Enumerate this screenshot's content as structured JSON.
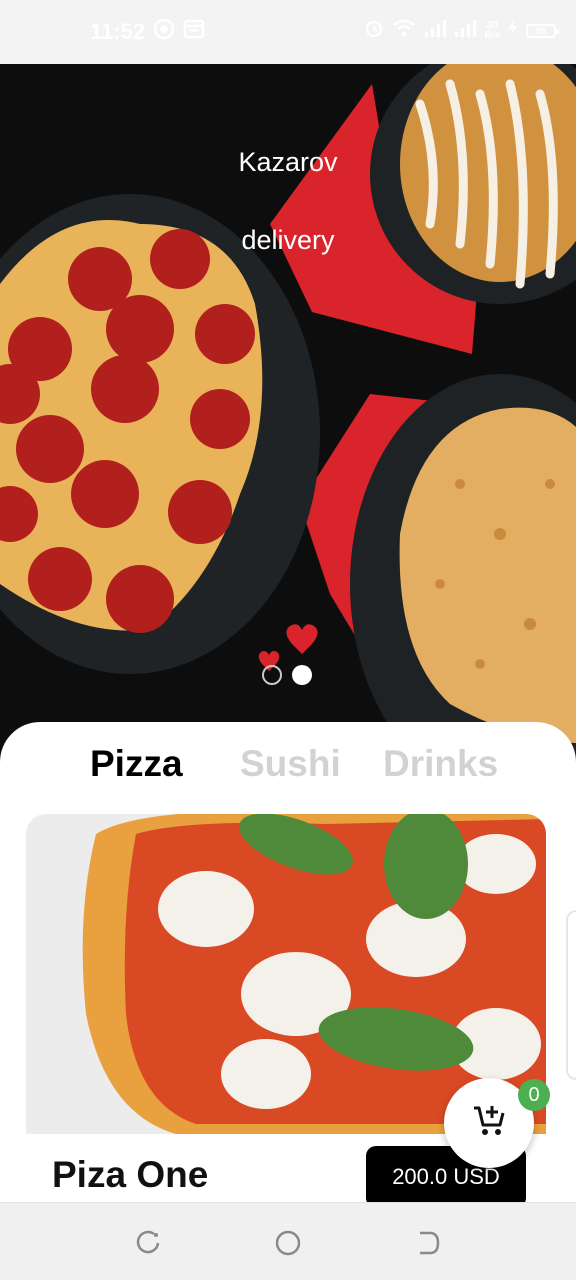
{
  "status_bar": {
    "time": "11:52",
    "net_speed_top": "30",
    "net_speed_bottom": "B/s",
    "battery": "55",
    "icons": [
      "whatsapp-icon",
      "calendar-icon",
      "alarm-icon",
      "wifi-icon",
      "signal-icon",
      "signal-icon",
      "charging-icon",
      "battery-icon"
    ]
  },
  "hero": {
    "title_line1": "Kazarov",
    "title_line2": "delivery",
    "carousel": {
      "count": 2,
      "active_index": 1
    }
  },
  "tabs": [
    {
      "label": "Pizza",
      "active": true
    },
    {
      "label": "Sushi",
      "active": false
    },
    {
      "label": "Drinks",
      "active": false
    }
  ],
  "product": {
    "name": "Piza One",
    "price": "200.0 USD"
  },
  "cart": {
    "count": "0",
    "icon": "add-to-cart-icon"
  },
  "nav": {
    "icons": [
      "recent-apps-icon",
      "home-icon",
      "back-icon"
    ]
  },
  "colors": {
    "hero_background": "#0d0d0e",
    "accent_red": "#e1262c",
    "badge_green": "#4caf50",
    "price_button": "#000000",
    "inactive_tab": "#d2d2d2"
  }
}
